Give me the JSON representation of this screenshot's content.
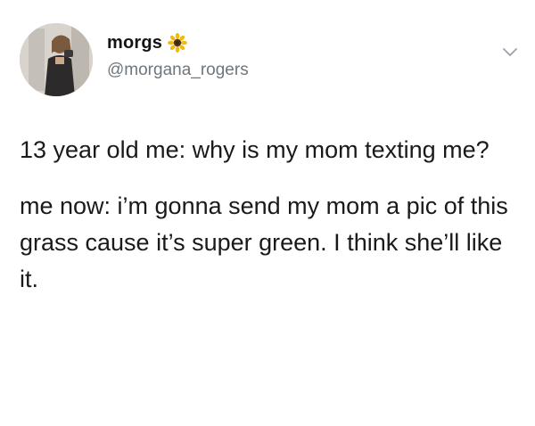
{
  "tweet": {
    "display_name": "morgs",
    "emoji": "sunflower-icon",
    "handle": "@morgana_rogers",
    "paragraphs": [
      "13 year old me: why is my mom texting me?",
      "me now: i’m gonna send my mom a pic of this grass cause it’s super green. I think she’ll like it."
    ]
  },
  "colors": {
    "text": "#1a1a1a",
    "handle": "#6e767d",
    "chevron": "#9aa3ab",
    "sunflower_petals": "#f2b90f",
    "sunflower_center": "#5a3a1a"
  }
}
